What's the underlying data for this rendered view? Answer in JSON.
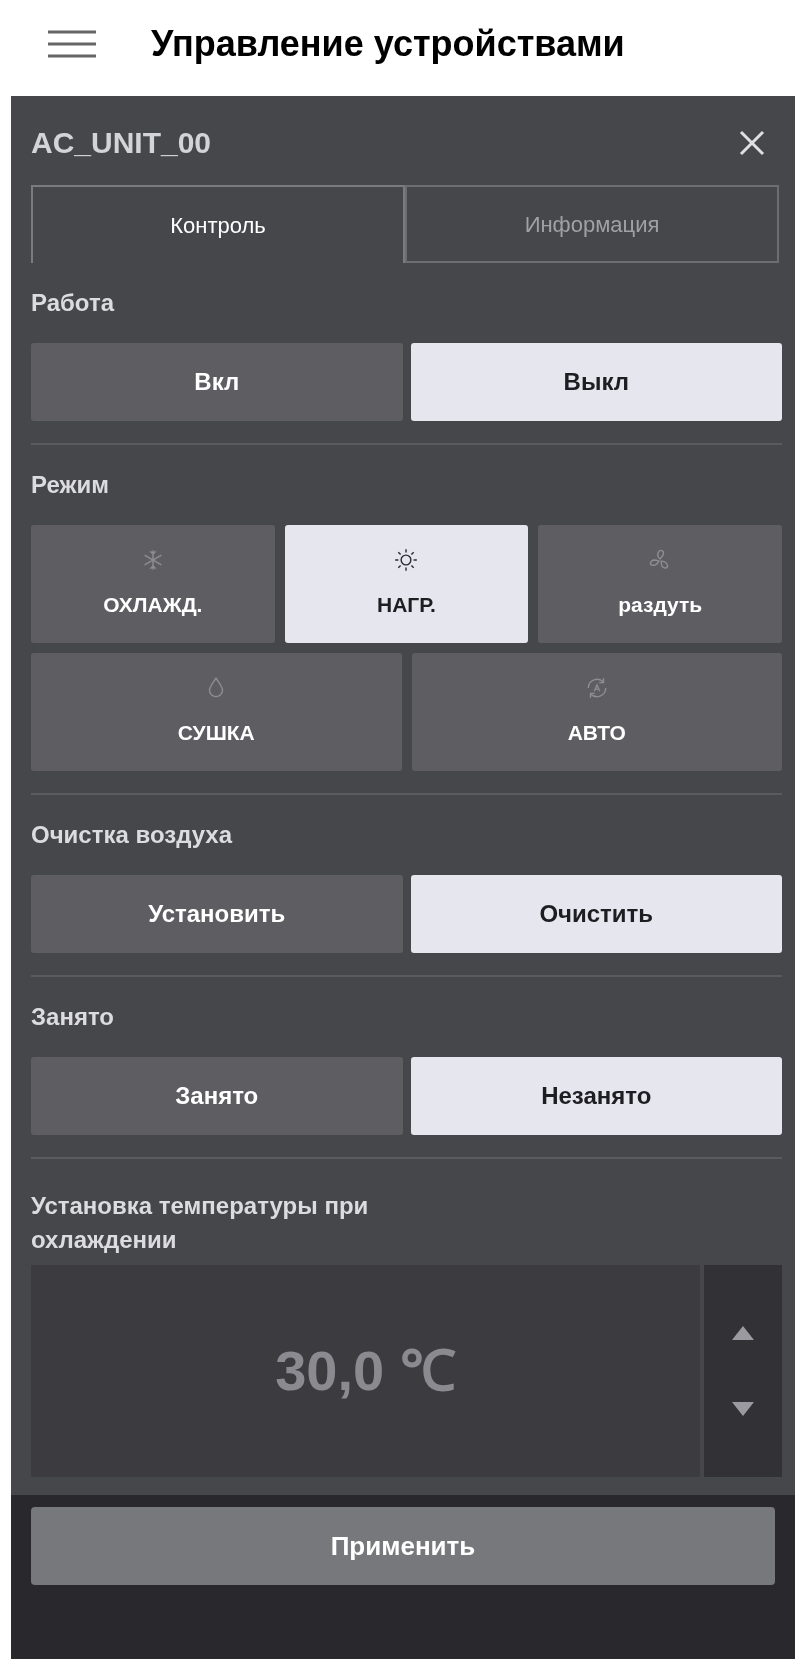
{
  "header": {
    "title": "Управление устройствами"
  },
  "panel": {
    "title": "AC_UNIT_00",
    "tabs": [
      {
        "label": "Контроль",
        "selected": true
      },
      {
        "label": "Информация",
        "selected": false
      }
    ],
    "sections": [
      {
        "kind": "toggle",
        "label": "Работа",
        "options": [
          {
            "label": "Вкл",
            "selected": false
          },
          {
            "label": "Выкл",
            "selected": true
          }
        ]
      },
      {
        "kind": "modes",
        "label": "Режим",
        "options": [
          {
            "label": "ОХЛАЖД.",
            "selected": false
          },
          {
            "label": "НАГР.",
            "selected": true
          },
          {
            "label": "раздуть",
            "selected": false
          },
          {
            "label": "СУШКА",
            "selected": false
          },
          {
            "label": "АВТО",
            "selected": false
          }
        ]
      },
      {
        "kind": "toggle",
        "label": "Очистка воздуха",
        "options": [
          {
            "label": "Установить",
            "selected": false
          },
          {
            "label": "Очистить",
            "selected": true
          }
        ]
      },
      {
        "kind": "toggle",
        "label": "Занято",
        "options": [
          {
            "label": "Занято",
            "selected": false
          },
          {
            "label": "Незанято",
            "selected": true
          }
        ]
      },
      {
        "kind": "temperature",
        "label": "Установка температуры при охлаждении",
        "value": "30,0 ℃"
      }
    ],
    "apply_button": "Применить"
  }
}
